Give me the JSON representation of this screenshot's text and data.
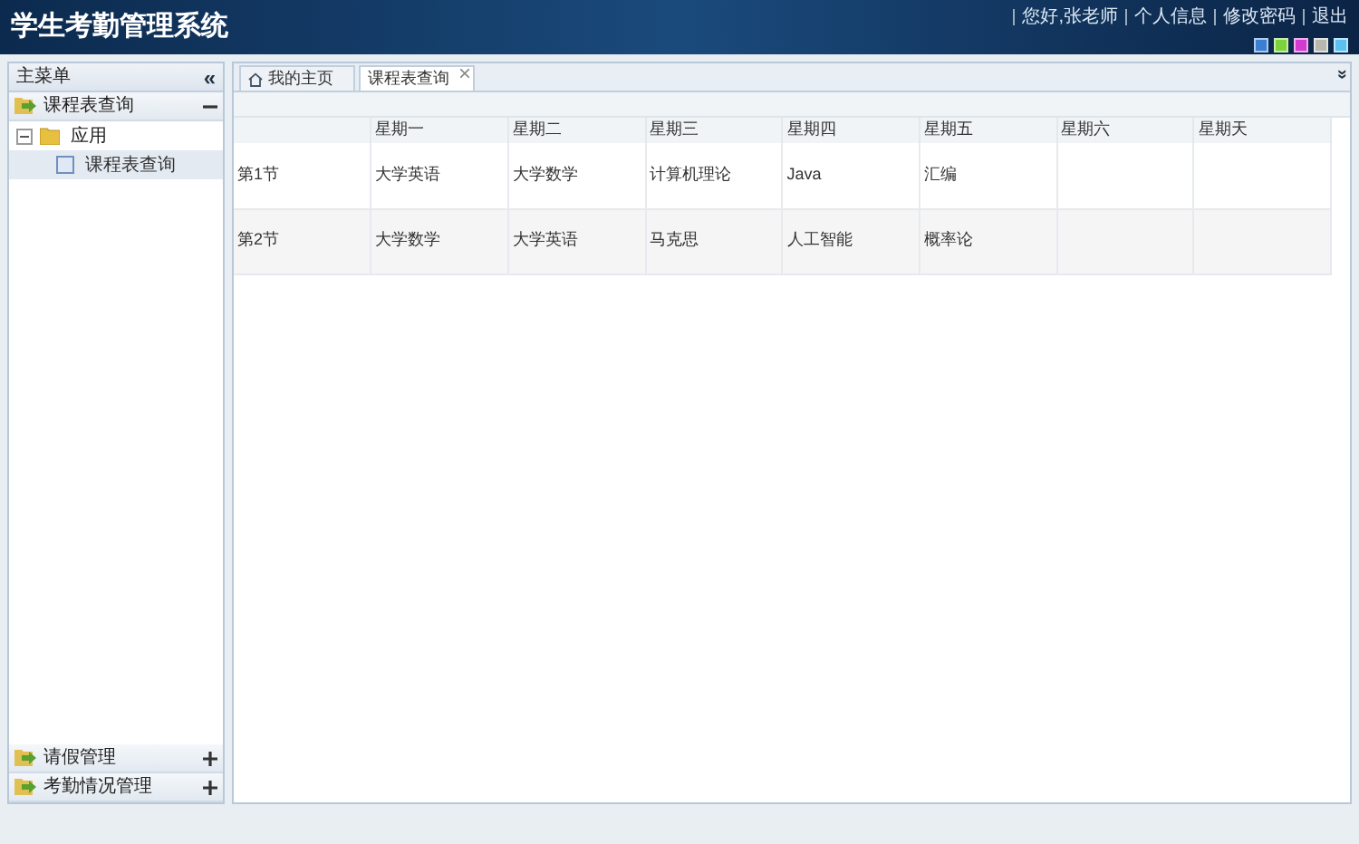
{
  "header": {
    "title": "学生考勤管理系统",
    "links": [
      "您好,张老师",
      "个人信息",
      "修改密码",
      "退出"
    ],
    "themes": [
      {
        "color": "#3a7fd0"
      },
      {
        "color": "#7ed23a"
      },
      {
        "color": "#d23ad0"
      },
      {
        "color": "#b8b8b0"
      },
      {
        "color": "#5cc0f0"
      }
    ]
  },
  "sidebar": {
    "title": "主菜单",
    "collapse": "«",
    "panels": [
      {
        "label": "课程表查询",
        "expanded": true,
        "tree": [
          {
            "label": "应用",
            "expanded": true,
            "selected": false,
            "children": [
              {
                "label": "课程表查询",
                "selected": true
              }
            ]
          }
        ]
      },
      {
        "label": "请假管理",
        "expanded": false
      },
      {
        "label": "考勤情况管理",
        "expanded": false
      }
    ]
  },
  "tabs": [
    {
      "label": "我的主页",
      "selected": false,
      "closable": false,
      "home": true
    },
    {
      "label": "课程表查询",
      "selected": true,
      "closable": true,
      "home": false
    }
  ],
  "tab_menu": "»",
  "table": {
    "columns": [
      "",
      "星期一",
      "星期二",
      "星期三",
      "星期四",
      "星期五",
      "星期六",
      "星期天"
    ],
    "rows": [
      [
        "第1节",
        "大学英语",
        "大学数学",
        "计算机理论",
        "Java",
        "汇编",
        "",
        ""
      ],
      [
        "第2节",
        "大学数学",
        "大学英语",
        "马克思",
        "人工智能",
        "概率论",
        "",
        ""
      ]
    ]
  }
}
